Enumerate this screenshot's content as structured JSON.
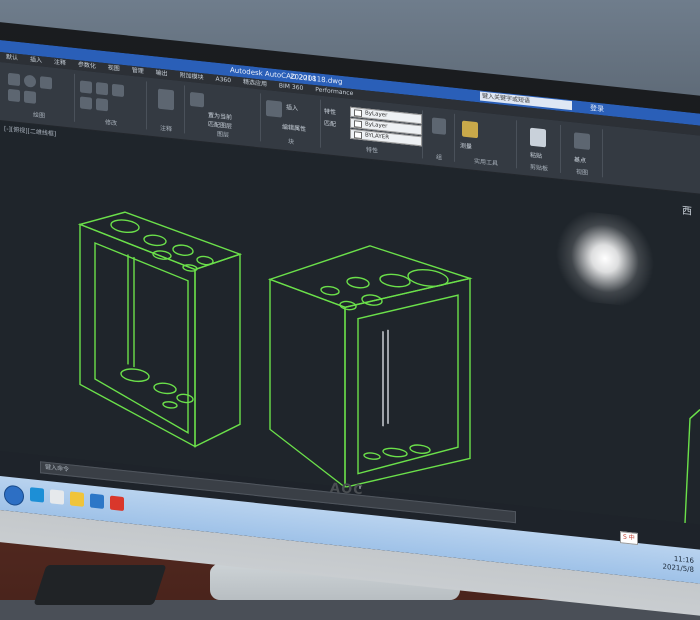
{
  "window": {
    "app_title": "Autodesk AutoCAD 2018",
    "file_name": "20220118.dwg",
    "search_placeholder": "键入关键字或短语",
    "login_label": "登录"
  },
  "menu_tabs": [
    "默认",
    "插入",
    "注释",
    "参数化",
    "视图",
    "管理",
    "输出",
    "附加模块",
    "A360",
    "精选应用",
    "BIM 360",
    "Performance"
  ],
  "ribbon": {
    "groups": [
      {
        "label": "绘图"
      },
      {
        "label": "修改"
      },
      {
        "label": "注释"
      },
      {
        "label": "图层"
      },
      {
        "label": "块"
      },
      {
        "label": "特性"
      },
      {
        "label": "组"
      },
      {
        "label": "实用工具"
      },
      {
        "label": "剪贴板"
      },
      {
        "label": "视图"
      }
    ],
    "layer_labels": {
      "bylayer_1": "ByLayer",
      "bylayer_2": "ByLayer",
      "bylayer_3": "BYLAYER"
    },
    "layer_tools": [
      "置为当前",
      "匹配图层"
    ],
    "edit_tools": [
      "插入",
      "编辑属性"
    ],
    "property_tools": [
      "特性",
      "匹配"
    ],
    "misc_tools": [
      "测量",
      "粘贴",
      "基点"
    ]
  },
  "canvas": {
    "file_tab": "[-][俯视][二维线框]",
    "side_text": "西",
    "drawing_color": "#6be04a",
    "background_color": "#1f252b"
  },
  "command_line": {
    "placeholder": "键入命令"
  },
  "taskbar": {
    "time": "11:16",
    "date": "2021/5/8",
    "ime_label": "S 中"
  },
  "monitor": {
    "brand": "AOC"
  }
}
